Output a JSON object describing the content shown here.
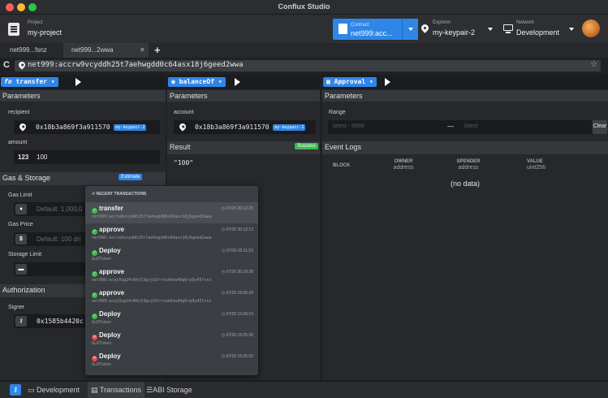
{
  "window": {
    "title": "Conflux Studio"
  },
  "header": {
    "project": {
      "label": "Project",
      "name": "my-project"
    },
    "contract": {
      "label": "Contract",
      "value": "net999:acc..."
    },
    "explorer": {
      "label": "Explorer",
      "value": "my-keypair-2"
    },
    "network": {
      "label": "Network",
      "value": "Development"
    }
  },
  "tabs": [
    {
      "label": "net999...fsnz",
      "active": false
    },
    {
      "label": "net999...2wwa",
      "active": true
    }
  ],
  "url": {
    "value": "net999:accrw9vcyddh25t7aehwgdd0c64asx18j6geed2wwa"
  },
  "panels": [
    {
      "method": "transfer",
      "method_prefix": "fn",
      "params_title": "Parameters",
      "recipient_label": "recipient",
      "recipient_value": "0x18b3a869f3a911570",
      "recipient_keypair": "my-keypair-2",
      "amount_label": "amount",
      "amount_type": "123",
      "amount_value": "100",
      "gas_title": "Gas & Storage",
      "estimate_label": "Estimate",
      "gas_limit_label": "Gas Limit",
      "gas_limit_placeholder": "Default: 1,000,0",
      "gas_price_label": "Gas Price",
      "gas_price_placeholder": "Default: 100 dri",
      "storage_limit_label": "Storage Limit",
      "auth_title": "Authorization",
      "signer_label": "Signer",
      "signer_value": "0x1585b4420c"
    },
    {
      "method": "balanceOf",
      "params_title": "Parameters",
      "account_label": "account",
      "account_value": "0x18b3a869f3a911570",
      "account_keypair": "my-keypair-2",
      "result_title": "Result",
      "result_status": "Success",
      "result_value": "\"100\""
    },
    {
      "method": "Approval",
      "params_title": "Parameters",
      "range_label": "Range",
      "range_from_placeholder": "latest - 9999",
      "range_sep": "—",
      "range_to_placeholder": "latest",
      "clear_label": "Clear",
      "logs_title": "Event Logs",
      "columns": [
        {
          "title": "BLOCK",
          "type": ""
        },
        {
          "title": "OWNER",
          "type": "address"
        },
        {
          "title": "SPENDER",
          "type": "address"
        },
        {
          "title": "VALUE",
          "type": "uint256"
        }
      ],
      "empty": "(no data)"
    }
  ],
  "recent_transactions": {
    "title": "RECENT TRANSACTIONS",
    "items": [
      {
        "name": "transfer",
        "sub": "net999:accrw9vcyddh25t7aehwgdd0c64asx18j6geed2wwa",
        "time": "07/20 20:12:20",
        "status": "success"
      },
      {
        "name": "approve",
        "sub": "net999:accrw9vcyddh25t7aehwgdd0c64asx18j6geed2wwa",
        "time": "07/20 20:12:12",
        "status": "success"
      },
      {
        "name": "Deploy",
        "sub": "GLDToken",
        "time": "07/20 20:11:52",
        "status": "success"
      },
      {
        "name": "approve",
        "sub": "net999:acaj0ug24r84j53gvjb3rrtwb0vw49g6rp9y45fsnz",
        "time": "07/20 20:10:38",
        "status": "success"
      },
      {
        "name": "approve",
        "sub": "net999:acaj0ug24r84j53gvjb3rrtwb0vw49g6rp9y45fsnz",
        "time": "07/20 19:26:29",
        "status": "success"
      },
      {
        "name": "Deploy",
        "sub": "GLDToken",
        "time": "07/20 19:26:10",
        "status": "success"
      },
      {
        "name": "Deploy",
        "sub": "GLDToken",
        "time": "07/20 19:25:26",
        "status": "error"
      },
      {
        "name": "Deploy",
        "sub": "GLDToken",
        "time": "07/20 19:25:02",
        "status": "error"
      }
    ]
  },
  "statusbar": {
    "development": "Development",
    "transactions": "Transactions",
    "abi_storage": "ABI Storage"
  },
  "colors": {
    "accent": "#2f86e6",
    "success": "#3fb950",
    "error": "#e5484d"
  }
}
